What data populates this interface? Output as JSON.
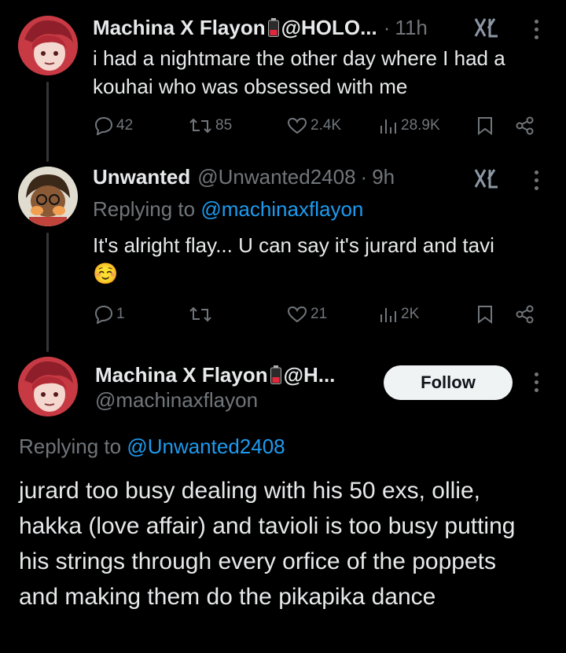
{
  "tweet1": {
    "name": "Machina X Flayon",
    "handle": "@HOLO...",
    "separator": "·",
    "time": "11h",
    "text": "i had a nightmare the other day where I had a kouhai who was obsessed with me",
    "replies": "42",
    "retweets": "85",
    "likes": "2.4K",
    "views": "28.9K"
  },
  "tweet2": {
    "name": "Unwanted",
    "handle": "@Unwanted2408",
    "separator": "·",
    "time": "9h",
    "replying_prefix": "Replying to",
    "replying_to": "@machinaxflayon",
    "text": "It's alright flay... U can say it's jurard and tavi",
    "emoji": "☺️",
    "replies": "1",
    "retweets": "",
    "likes": "21",
    "views": "2K"
  },
  "main_tweet": {
    "name": "Machina X Flayon",
    "handle_truncated": "@H...",
    "username": "@machinaxflayon",
    "follow_label": "Follow",
    "replying_prefix": "Replying to",
    "replying_to": "@Unwanted2408",
    "text": "jurard too busy dealing with his 50 exs, ollie, hakka (love affair) and tavioli is too busy putting his strings through every orfice of the poppets and making them do the pikapika dance"
  },
  "colors": {
    "background": "#000000",
    "text": "#e7e9ea",
    "secondary": "#71767b",
    "link": "#1d9bf0",
    "follow_bg": "#eff3f4"
  },
  "icons": [
    "battery-icon",
    "grok-icon",
    "more-icon",
    "reply-icon",
    "retweet-icon",
    "like-icon",
    "views-icon",
    "bookmark-icon",
    "share-icon"
  ]
}
